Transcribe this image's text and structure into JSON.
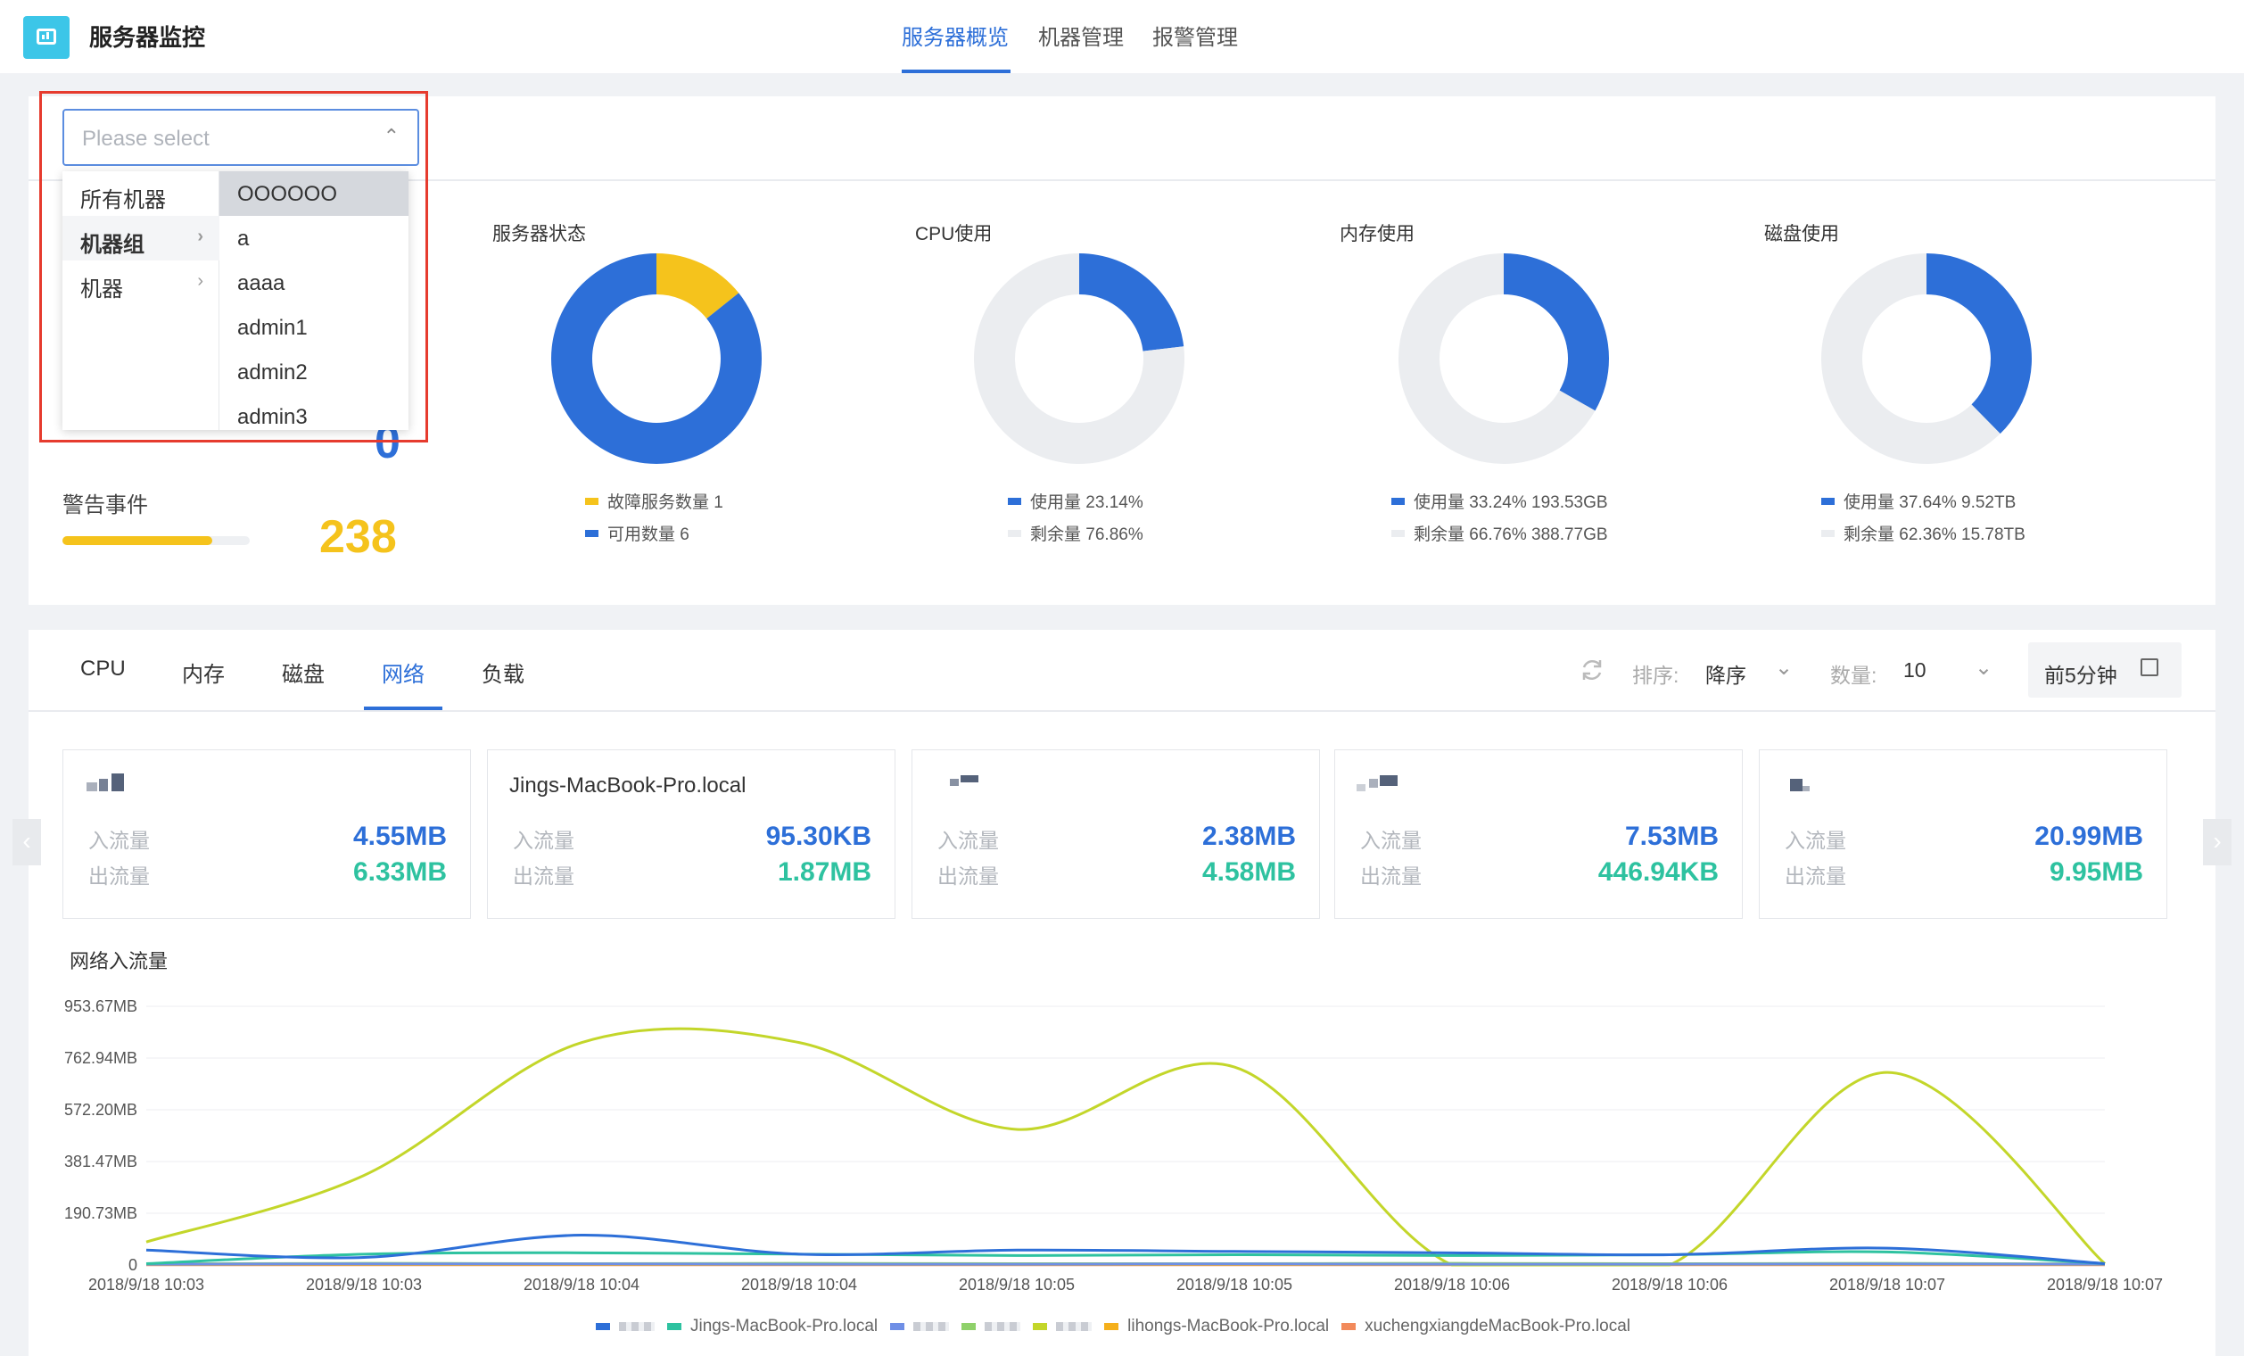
{
  "header": {
    "app_title": "服务器监控",
    "nav": [
      {
        "label": "服务器概览",
        "active": true
      },
      {
        "label": "机器管理",
        "active": false
      },
      {
        "label": "报警管理",
        "active": false
      }
    ]
  },
  "select": {
    "placeholder": "Please select",
    "caret_icon": "chevron-up-icon",
    "categories": [
      {
        "label": "所有机器",
        "has_children": false
      },
      {
        "label": "机器组",
        "has_children": true
      },
      {
        "label": "机器",
        "has_children": true
      }
    ],
    "options": [
      "OOOOOO",
      "a",
      "aaaa",
      "admin1",
      "admin2",
      "admin3"
    ],
    "selected_option": "OOOOOO"
  },
  "overview": {
    "hidden_value": "0",
    "alert_label": "警告事件",
    "alert_value": "238",
    "alert_progress": 0.8
  },
  "donuts": [
    {
      "title": "服务器状态",
      "segments": [
        {
          "label": "故障服务数量",
          "value": 1,
          "color": "#f5c31c"
        },
        {
          "label": "可用数量",
          "value": 6,
          "color": "#2d6fd8"
        }
      ],
      "legend": [
        {
          "text": "故障服务数量   1",
          "color": "#f5c31c"
        },
        {
          "text": "可用数量   6",
          "color": "#2d6fd8"
        }
      ]
    },
    {
      "title": "CPU使用",
      "segments": [
        {
          "label": "使用量",
          "value": 23.14,
          "color": "#2d6fd8"
        },
        {
          "label": "剩余量",
          "value": 76.86,
          "color": "#ebedf0"
        }
      ],
      "legend": [
        {
          "text": "使用量 23.14%",
          "color": "#2d6fd8"
        },
        {
          "text": "剩余量 76.86%",
          "color": "#ebedf0"
        }
      ]
    },
    {
      "title": "内存使用",
      "segments": [
        {
          "label": "使用量",
          "value": 33.24,
          "color": "#2d6fd8"
        },
        {
          "label": "剩余量",
          "value": 66.76,
          "color": "#ebedf0"
        }
      ],
      "legend": [
        {
          "text": "使用量 33.24% 193.53GB",
          "color": "#2d6fd8"
        },
        {
          "text": "剩余量 66.76% 388.77GB",
          "color": "#ebedf0"
        }
      ]
    },
    {
      "title": "磁盘使用",
      "segments": [
        {
          "label": "使用量",
          "value": 37.64,
          "color": "#2d6fd8"
        },
        {
          "label": "剩余量",
          "value": 62.36,
          "color": "#ebedf0"
        }
      ],
      "legend": [
        {
          "text": "使用量 37.64% 9.52TB",
          "color": "#2d6fd8"
        },
        {
          "text": "剩余量 62.36% 15.78TB",
          "color": "#ebedf0"
        }
      ]
    }
  ],
  "tabs": [
    {
      "label": "CPU",
      "active": false
    },
    {
      "label": "内存",
      "active": false
    },
    {
      "label": "磁盘",
      "active": false
    },
    {
      "label": "网络",
      "active": true
    },
    {
      "label": "负载",
      "active": false
    }
  ],
  "toolbar": {
    "refresh_icon": "refresh-icon",
    "sort_label": "排序:",
    "sort_value": "降序",
    "count_label": "数量:",
    "count_value": "10",
    "time_button": "前5分钟",
    "calendar_icon": "calendar-icon"
  },
  "cards": [
    {
      "title": "",
      "in_label": "入流量",
      "in_value": "4.55MB",
      "out_label": "出流量",
      "out_value": "6.33MB"
    },
    {
      "title": "Jings-MacBook-Pro.local",
      "in_label": "入流量",
      "in_value": "95.30KB",
      "out_label": "出流量",
      "out_value": "1.87MB"
    },
    {
      "title": "",
      "in_label": "入流量",
      "in_value": "2.38MB",
      "out_label": "出流量",
      "out_value": "4.58MB"
    },
    {
      "title": "",
      "in_label": "入流量",
      "in_value": "7.53MB",
      "out_label": "出流量",
      "out_value": "446.94KB"
    },
    {
      "title": "",
      "in_label": "入流量",
      "in_value": "20.99MB",
      "out_label": "出流量",
      "out_value": "9.95MB"
    }
  ],
  "chart_data": {
    "type": "line",
    "title": "网络入流量",
    "y_ticks": [
      "0",
      "190.73MB",
      "381.47MB",
      "572.20MB",
      "762.94MB",
      "953.67MB"
    ],
    "ylim": [
      0,
      953.67
    ],
    "x": [
      "2018/9/18 10:03",
      "2018/9/18 10:03",
      "2018/9/18 10:04",
      "2018/9/18 10:04",
      "2018/9/18 10:05",
      "2018/9/18 10:05",
      "2018/9/18 10:06",
      "2018/9/18 10:06",
      "2018/9/18 10:07",
      "2018/9/18 10:07"
    ],
    "grid": true,
    "series": [
      {
        "name": "",
        "color": "#2d6fd8",
        "values": [
          55,
          28,
          110,
          40,
          55,
          50,
          45,
          38,
          62,
          5
        ]
      },
      {
        "name": "Jings-MacBook-Pro.local",
        "color": "#2ec2a0",
        "values": [
          5,
          40,
          45,
          40,
          35,
          38,
          35,
          38,
          48,
          5
        ]
      },
      {
        "name": "",
        "color": "#6f8fe6",
        "values": [
          3,
          4,
          4,
          3,
          3,
          4,
          3,
          3,
          4,
          3
        ]
      },
      {
        "name": "",
        "color": "#8fd16a",
        "values": [
          4,
          6,
          5,
          6,
          5,
          5,
          6,
          5,
          6,
          4
        ]
      },
      {
        "name": "",
        "color": "#c3d62a",
        "values": [
          85,
          330,
          820,
          820,
          500,
          730,
          0,
          0,
          710,
          5
        ]
      },
      {
        "name": "lihongs-MacBook-Pro.local",
        "color": "#f5b01c",
        "values": [
          2,
          2,
          2,
          2,
          2,
          2,
          2,
          2,
          2,
          2
        ]
      },
      {
        "name": "xuchengxiangdeMacBook-Pro.local",
        "color": "#f28a5b",
        "values": [
          1,
          1,
          1,
          1,
          1,
          1,
          1,
          1,
          1,
          1
        ]
      }
    ]
  }
}
